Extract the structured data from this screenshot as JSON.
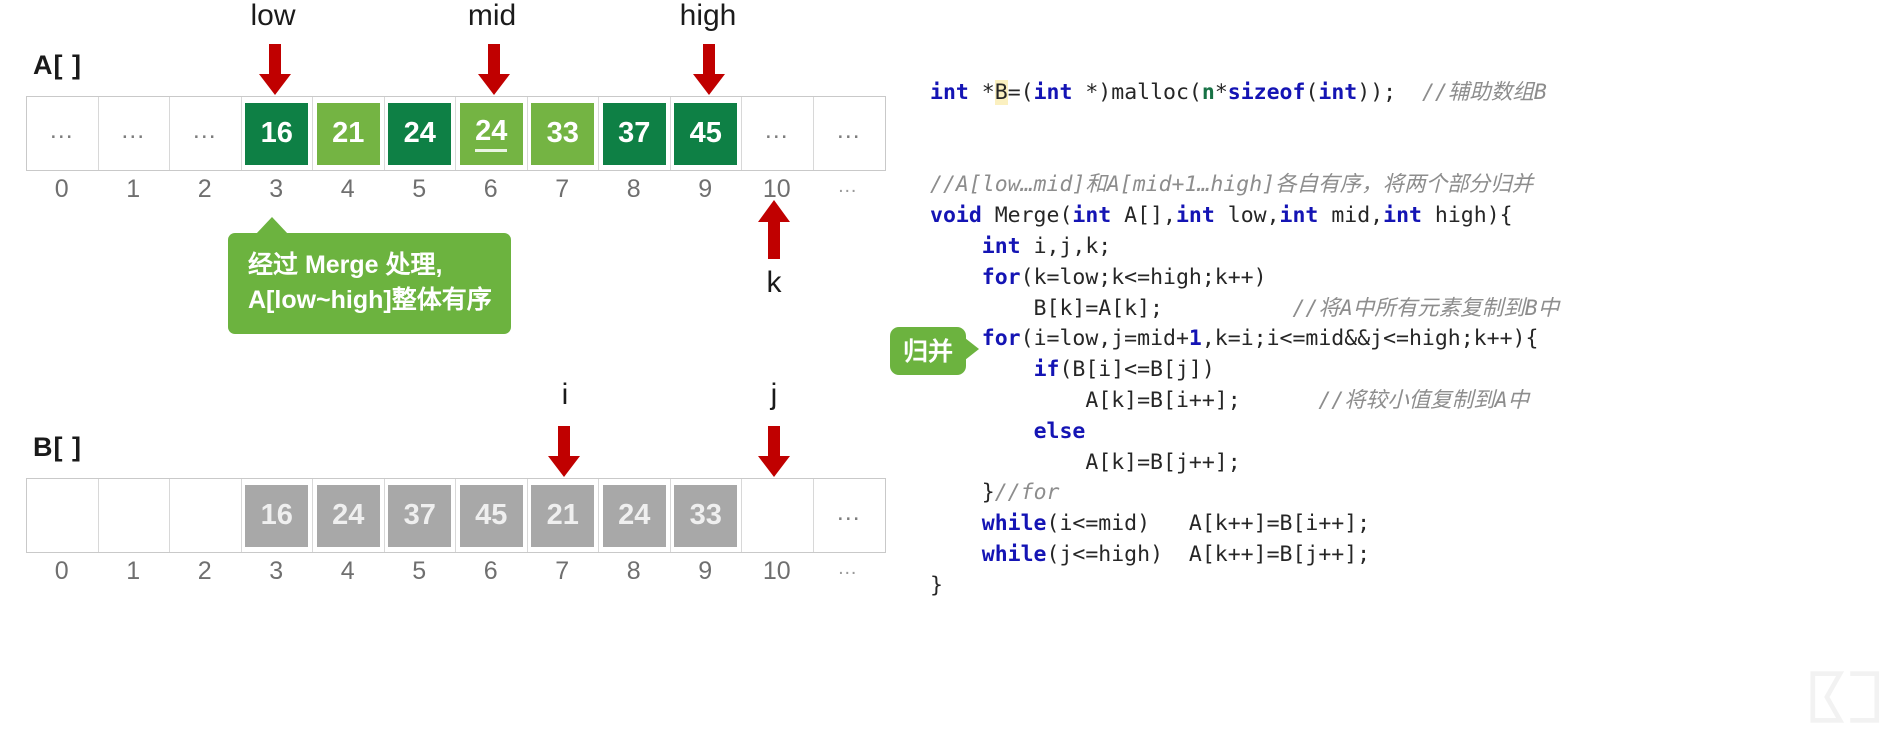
{
  "arrays": {
    "a": {
      "label": "A[ ]",
      "cells": [
        {
          "value": "…",
          "style": "empty"
        },
        {
          "value": "…",
          "style": "empty"
        },
        {
          "value": "…",
          "style": "empty"
        },
        {
          "value": "16",
          "style": "dark"
        },
        {
          "value": "21",
          "style": "light"
        },
        {
          "value": "24",
          "style": "dark"
        },
        {
          "value": "24",
          "style": "light-underline"
        },
        {
          "value": "33",
          "style": "light"
        },
        {
          "value": "37",
          "style": "dark"
        },
        {
          "value": "45",
          "style": "dark"
        },
        {
          "value": "…",
          "style": "empty"
        },
        {
          "value": "…",
          "style": "empty"
        }
      ],
      "indices": [
        "0",
        "1",
        "2",
        "3",
        "4",
        "5",
        "6",
        "7",
        "8",
        "9",
        "10",
        "…"
      ]
    },
    "b": {
      "label": "B[ ]",
      "cells": [
        {
          "value": "",
          "style": "empty"
        },
        {
          "value": "",
          "style": "empty"
        },
        {
          "value": "",
          "style": "empty"
        },
        {
          "value": "16",
          "style": "gray"
        },
        {
          "value": "24",
          "style": "gray"
        },
        {
          "value": "37",
          "style": "gray"
        },
        {
          "value": "45",
          "style": "gray"
        },
        {
          "value": "21",
          "style": "gray"
        },
        {
          "value": "24",
          "style": "gray"
        },
        {
          "value": "33",
          "style": "gray"
        },
        {
          "value": "",
          "style": "empty"
        },
        {
          "value": "…",
          "style": "empty"
        }
      ],
      "indices": [
        "0",
        "1",
        "2",
        "3",
        "4",
        "5",
        "6",
        "7",
        "8",
        "9",
        "10",
        "…"
      ]
    }
  },
  "pointers": {
    "low": "low",
    "mid": "mid",
    "high": "high",
    "k": "k",
    "i": "i",
    "j": "j"
  },
  "callout": {
    "line1": "经过 Merge 处理,",
    "line2": "A[low~high]整体有序"
  },
  "badge": {
    "label": "归并"
  },
  "code": {
    "lines": [
      {
        "id": "malloc",
        "tokens": [
          {
            "t": "int",
            "c": "kw"
          },
          {
            "t": " *",
            "c": "plain"
          },
          {
            "t": "B",
            "c": "hl"
          },
          {
            "t": "=(",
            "c": "plain"
          },
          {
            "t": "int",
            "c": "kw"
          },
          {
            "t": " *)malloc(",
            "c": "plain"
          },
          {
            "t": "n",
            "c": "var-g"
          },
          {
            "t": "*",
            "c": "plain"
          },
          {
            "t": "sizeof",
            "c": "kw"
          },
          {
            "t": "(",
            "c": "plain"
          },
          {
            "t": "int",
            "c": "kw"
          },
          {
            "t": "));  ",
            "c": "plain"
          },
          {
            "t": "//辅助数组B",
            "c": "cm"
          }
        ]
      },
      {
        "id": "blank1",
        "tokens": []
      },
      {
        "id": "blank2",
        "tokens": []
      },
      {
        "id": "comment-merge",
        "tokens": [
          {
            "t": "//A[low…mid]和A[mid+1…high]各自有序，将两个部分归并",
            "c": "cm"
          }
        ]
      },
      {
        "id": "fn-sig",
        "tokens": [
          {
            "t": "void",
            "c": "kw"
          },
          {
            "t": " Merge(",
            "c": "plain"
          },
          {
            "t": "int",
            "c": "kw"
          },
          {
            "t": " A[],",
            "c": "plain"
          },
          {
            "t": "int",
            "c": "kw"
          },
          {
            "t": " low,",
            "c": "plain"
          },
          {
            "t": "int",
            "c": "kw"
          },
          {
            "t": " mid,",
            "c": "plain"
          },
          {
            "t": "int",
            "c": "kw"
          },
          {
            "t": " high){",
            "c": "plain"
          }
        ]
      },
      {
        "id": "decl-ijk",
        "tokens": [
          {
            "t": "    ",
            "c": "plain"
          },
          {
            "t": "int",
            "c": "kw"
          },
          {
            "t": " i,j,k;",
            "c": "plain"
          }
        ]
      },
      {
        "id": "for-copy",
        "tokens": [
          {
            "t": "    ",
            "c": "plain"
          },
          {
            "t": "for",
            "c": "kw"
          },
          {
            "t": "(k=low;k<=high;k++)",
            "c": "plain"
          }
        ]
      },
      {
        "id": "copy-body",
        "tokens": [
          {
            "t": "        B[k]=A[k];          ",
            "c": "plain"
          },
          {
            "t": "//将A中所有元素复制到B中",
            "c": "cm"
          }
        ]
      },
      {
        "id": "for-merge",
        "tokens": [
          {
            "t": "    ",
            "c": "plain"
          },
          {
            "t": "for",
            "c": "kw"
          },
          {
            "t": "(i=low,j=mid+",
            "c": "plain"
          },
          {
            "t": "1",
            "c": "num"
          },
          {
            "t": ",k=i;i<=mid&&j<=high;k++){",
            "c": "plain"
          }
        ]
      },
      {
        "id": "if-cmp",
        "tokens": [
          {
            "t": "        ",
            "c": "plain"
          },
          {
            "t": "if",
            "c": "kw"
          },
          {
            "t": "(B[i]<=B[j])",
            "c": "plain"
          }
        ]
      },
      {
        "id": "if-body",
        "tokens": [
          {
            "t": "            A[k]=B[i++];      ",
            "c": "plain"
          },
          {
            "t": "//将较小值复制到A中",
            "c": "cm"
          }
        ]
      },
      {
        "id": "else-kw",
        "tokens": [
          {
            "t": "        ",
            "c": "plain"
          },
          {
            "t": "else",
            "c": "kw"
          }
        ]
      },
      {
        "id": "else-body",
        "tokens": [
          {
            "t": "            A[k]=B[j++];",
            "c": "plain"
          }
        ]
      },
      {
        "id": "close-for",
        "tokens": [
          {
            "t": "    }",
            "c": "plain"
          },
          {
            "t": "//for",
            "c": "cm"
          }
        ]
      },
      {
        "id": "while-i",
        "tokens": [
          {
            "t": "    ",
            "c": "plain"
          },
          {
            "t": "while",
            "c": "kw"
          },
          {
            "t": "(i<=mid)   A[k++]=B[i++];",
            "c": "plain"
          }
        ]
      },
      {
        "id": "while-j",
        "tokens": [
          {
            "t": "    ",
            "c": "plain"
          },
          {
            "t": "while",
            "c": "kw"
          },
          {
            "t": "(j<=high)  A[k++]=B[j++];",
            "c": "plain"
          }
        ]
      },
      {
        "id": "close-fn",
        "tokens": [
          {
            "t": "}",
            "c": "plain"
          }
        ]
      }
    ]
  },
  "colors": {
    "dark_green": "#0e8045",
    "light_green": "#74b443",
    "gray_chip": "#a8a8a8",
    "arrow_red": "#c00000",
    "callout_green": "#6cb33f",
    "keyword_blue": "#1414b4",
    "comment_gray": "#8d8d8d"
  }
}
